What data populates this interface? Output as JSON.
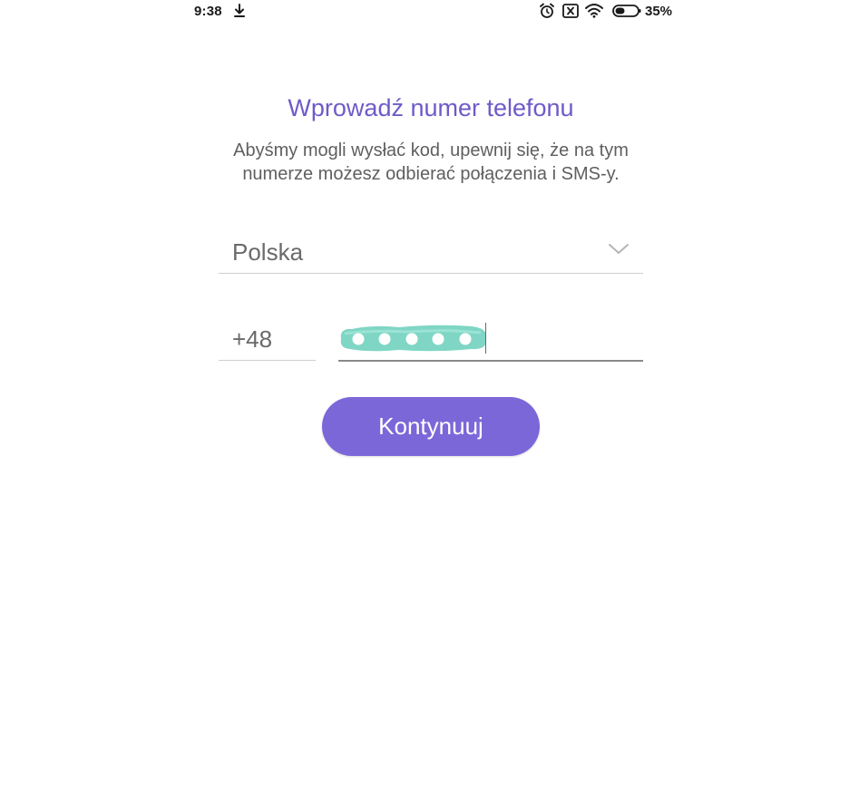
{
  "status_bar": {
    "time": "9:38",
    "battery_percent": "35%",
    "icons": [
      "download-icon",
      "alarm-icon",
      "sim-icon",
      "wifi-icon",
      "battery-icon"
    ]
  },
  "screen": {
    "title": "Wprowadź numer telefonu",
    "subtitle_line1": "Abyśmy mogli wysłać kod, upewnij się, że na tym",
    "subtitle_line2": "numerze możesz odbierać połączenia i SMS-y."
  },
  "form": {
    "country": "Polska",
    "country_code": "+48",
    "continue_label": "Kontynuuj"
  },
  "colors": {
    "accent": "#7c67d9",
    "title": "#6f5ac9",
    "scribble": "#7fd6c5"
  }
}
